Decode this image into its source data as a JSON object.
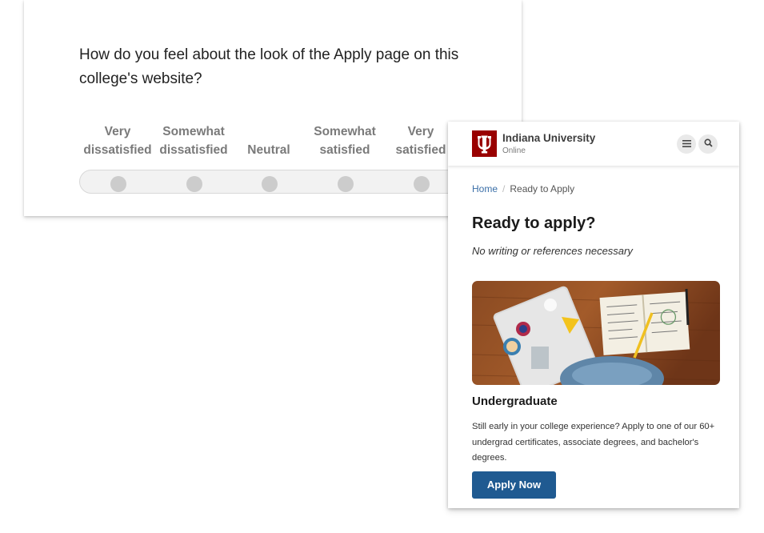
{
  "survey": {
    "question": "How do you feel about the look of the Apply page on this college's website?",
    "scale": [
      {
        "line1": "Very",
        "line2": "dissatisfied"
      },
      {
        "line1": "Somewhat",
        "line2": "dissatisfied"
      },
      {
        "line1": "",
        "line2": "Neutral"
      },
      {
        "line1": "Somewhat",
        "line2": "satisfied"
      },
      {
        "line1": "Very",
        "line2": "satisfied"
      }
    ]
  },
  "phone": {
    "brand": {
      "name": "Indiana University",
      "sub": "Online",
      "logo_color": "#990000"
    },
    "breadcrumb": {
      "home": "Home",
      "separator": "/",
      "current": "Ready to Apply"
    },
    "title": "Ready to apply?",
    "subtitle": "No writing or references necessary",
    "section": {
      "title": "Undergraduate",
      "body": "Still early in your college experience? Apply to one of our 60+ undergrad certificates, associate degrees, and bachelor's degrees."
    },
    "apply_button": "Apply Now",
    "accent_color": "#1f5a91",
    "icons": {
      "menu": "menu-icon",
      "search": "search-icon"
    }
  }
}
